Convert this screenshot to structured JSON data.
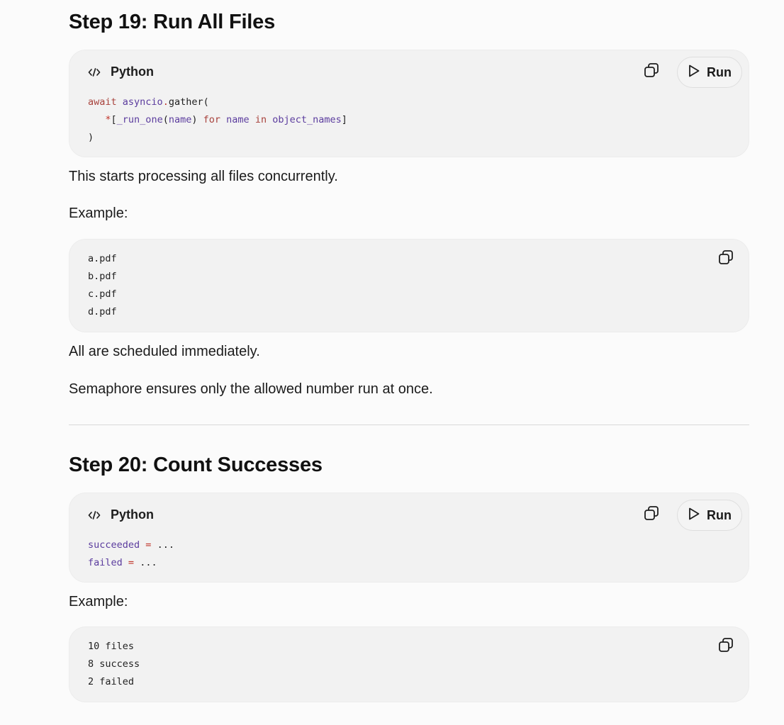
{
  "sections": [
    {
      "title": "Step 19: Run All Files",
      "code_block": {
        "language": "Python",
        "run_label": "Run",
        "lines": [
          [
            {
              "t": "await",
              "c": "kw"
            },
            {
              "t": " ",
              "c": "pl"
            },
            {
              "t": "asyncio",
              "c": "nm"
            },
            {
              "t": ".",
              "c": "op"
            },
            {
              "t": "gather(",
              "c": "pl"
            }
          ],
          [
            {
              "t": "   ",
              "c": "pl"
            },
            {
              "t": "*",
              "c": "op"
            },
            {
              "t": "[",
              "c": "pl"
            },
            {
              "t": "_run_one",
              "c": "nm"
            },
            {
              "t": "(",
              "c": "pl"
            },
            {
              "t": "name",
              "c": "nm"
            },
            {
              "t": ") ",
              "c": "pl"
            },
            {
              "t": "for",
              "c": "kw"
            },
            {
              "t": " ",
              "c": "pl"
            },
            {
              "t": "name",
              "c": "nm"
            },
            {
              "t": " ",
              "c": "pl"
            },
            {
              "t": "in",
              "c": "kw"
            },
            {
              "t": " ",
              "c": "pl"
            },
            {
              "t": "object_names",
              "c": "nm"
            },
            {
              "t": "]",
              "c": "pl"
            }
          ],
          [
            {
              "t": ")",
              "c": "pl"
            }
          ]
        ]
      },
      "paragraph_1": "This starts processing all files concurrently.",
      "example_label": "Example:",
      "example_block": {
        "lines": [
          "a.pdf",
          "b.pdf",
          "c.pdf",
          "d.pdf"
        ]
      },
      "paragraph_2": "All are scheduled immediately.",
      "paragraph_3": "Semaphore ensures only the allowed number run at once."
    },
    {
      "title": "Step 20: Count Successes",
      "code_block": {
        "language": "Python",
        "run_label": "Run",
        "lines": [
          [
            {
              "t": "succeeded",
              "c": "nm"
            },
            {
              "t": " ",
              "c": "pl"
            },
            {
              "t": "=",
              "c": "op"
            },
            {
              "t": " ...",
              "c": "pl"
            }
          ],
          [
            {
              "t": "failed",
              "c": "nm"
            },
            {
              "t": " ",
              "c": "pl"
            },
            {
              "t": "=",
              "c": "op"
            },
            {
              "t": " ...",
              "c": "pl"
            }
          ]
        ]
      },
      "example_label": "Example:",
      "example_block": {
        "lines": [
          "10 files",
          "8 success",
          "2 failed"
        ]
      }
    }
  ],
  "colors": {
    "page_bg": "#fbfbfb",
    "code_bg": "#f2f2f2",
    "keyword": "#a8423c",
    "identifier": "#5b3c9e",
    "operator": "#c0352b"
  },
  "icons": {
    "language": "code-brackets-icon",
    "copy": "copy-icon",
    "run": "play-icon"
  }
}
